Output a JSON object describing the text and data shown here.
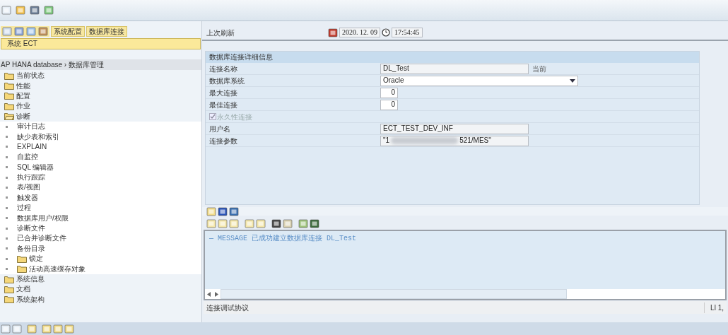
{
  "left_toolbar": {
    "buttons": [
      {
        "label": "系统配置"
      },
      {
        "label": "数据库连接"
      }
    ]
  },
  "system_field": {
    "value": "系统 ECT"
  },
  "breadcrumb": "AP HANA database › 数据库管理",
  "tree": [
    {
      "label": "当前状态",
      "kind": "folder",
      "expanded": false
    },
    {
      "label": "性能",
      "kind": "folder",
      "expanded": false
    },
    {
      "label": "配置",
      "kind": "folder",
      "expanded": false
    },
    {
      "label": "作业",
      "kind": "folder",
      "expanded": false
    },
    {
      "label": "诊断",
      "kind": "folder",
      "expanded": true,
      "children": [
        {
          "label": "审计日志",
          "kind": "leaf"
        },
        {
          "label": "缺少表和索引",
          "kind": "leaf"
        },
        {
          "label": "EXPLAIN",
          "kind": "leaf"
        },
        {
          "label": "自监控",
          "kind": "leaf"
        },
        {
          "label": "SQL 编辑器",
          "kind": "leaf"
        },
        {
          "label": "执行跟踪",
          "kind": "leaf"
        },
        {
          "label": "表/视图",
          "kind": "leaf"
        },
        {
          "label": "触发器",
          "kind": "leaf"
        },
        {
          "label": "过程",
          "kind": "leaf"
        },
        {
          "label": "数据库用户/权限",
          "kind": "leaf"
        },
        {
          "label": "诊断文件",
          "kind": "leaf"
        },
        {
          "label": "已合并诊断文件",
          "kind": "leaf"
        },
        {
          "label": "备份目录",
          "kind": "leaf"
        },
        {
          "label": "锁定",
          "kind": "folder",
          "expanded": false
        },
        {
          "label": "活动高速缓存对象",
          "kind": "folder",
          "expanded": false
        }
      ]
    },
    {
      "label": "系统信息",
      "kind": "folder",
      "expanded": false
    },
    {
      "label": "文档",
      "kind": "folder",
      "expanded": false
    },
    {
      "label": "系统架构",
      "kind": "folder",
      "expanded": false
    }
  ],
  "last_refresh": {
    "label": "上次刷新",
    "date": "2020. 12. 09",
    "time": "17:54:45"
  },
  "details": {
    "title": "数据库连接详细信息",
    "fields": [
      {
        "label": "连接名称",
        "kind": "text",
        "value": "DL_Test",
        "note": "当前"
      },
      {
        "label": "数据库系统",
        "kind": "dropdown",
        "value": "Oracle"
      },
      {
        "label": "最大连接",
        "kind": "number",
        "value": "0"
      },
      {
        "label": "最佳连接",
        "kind": "number",
        "value": "0"
      },
      {
        "label": "永久性连接",
        "kind": "checkbox",
        "checked": true,
        "disabled": true
      },
      {
        "label": "用户名",
        "kind": "text",
        "value": "ECT_TEST_DEV_INF"
      },
      {
        "label": "连接参数",
        "kind": "redacted",
        "value_start": "\"1",
        "value_end": "521/MES\""
      }
    ]
  },
  "log": {
    "lines": [
      "— MESSAGE 已成功建立数据库连接 DL_Test"
    ]
  },
  "status_bar": {
    "text": "连接调试协议",
    "position": "Ll 1,"
  }
}
